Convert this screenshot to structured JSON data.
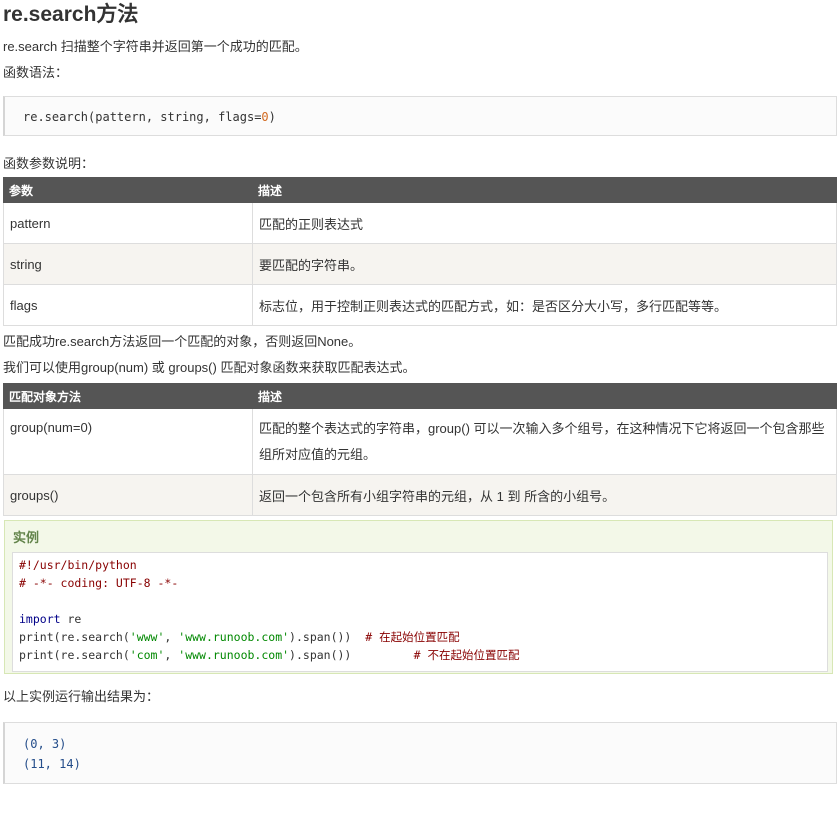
{
  "title": "re.search方法",
  "intro": "re.search 扫描整个字符串并返回第一个成功的匹配。",
  "syntax_label": "函数语法：",
  "syntax_code": {
    "prefix": "re.search(pattern, string, flags=",
    "number": "0",
    "suffix": ")"
  },
  "params_label": "函数参数说明：",
  "params_table": {
    "headers": [
      "参数",
      "描述"
    ],
    "rows": [
      [
        "pattern",
        "匹配的正则表达式"
      ],
      [
        "string",
        "要匹配的字符串。"
      ],
      [
        "flags",
        "标志位，用于控制正则表达式的匹配方式，如：是否区分大小写，多行匹配等等。"
      ]
    ]
  },
  "return_text": "匹配成功re.search方法返回一个匹配的对象，否则返回None。",
  "group_text": "我们可以使用group(num) 或 groups() 匹配对象函数来获取匹配表达式。",
  "methods_table": {
    "headers": [
      "匹配对象方法",
      "描述"
    ],
    "rows": [
      [
        "group(num=0)",
        "匹配的整个表达式的字符串，group() 可以一次输入多个组号，在这种情况下它将返回一个包含那些组所对应值的元组。"
      ],
      [
        "groups()",
        "返回一个包含所有小组字符串的元组，从 1 到 所含的小组号。"
      ]
    ]
  },
  "example": {
    "heading": "实例",
    "lines": {
      "shebang": "#!/usr/bin/python",
      "coding": "# -*- coding: UTF-8 -*-",
      "import_kw": "import",
      "import_mod": " re",
      "print1_a": "print(re.search(",
      "print1_s1": "'www'",
      "print1_b": ", ",
      "print1_s2": "'www.runoob.com'",
      "print1_c": ").span())  ",
      "print1_comment": "# 在起始位置匹配",
      "print2_a": "print(re.search(",
      "print2_s1": "'com'",
      "print2_b": ", ",
      "print2_s2": "'www.runoob.com'",
      "print2_c": ").span())         ",
      "print2_comment": "# 不在起始位置匹配"
    }
  },
  "output_label": "以上实例运行输出结果为：",
  "output_lines": [
    "(0, 3)",
    "(11, 14)"
  ]
}
